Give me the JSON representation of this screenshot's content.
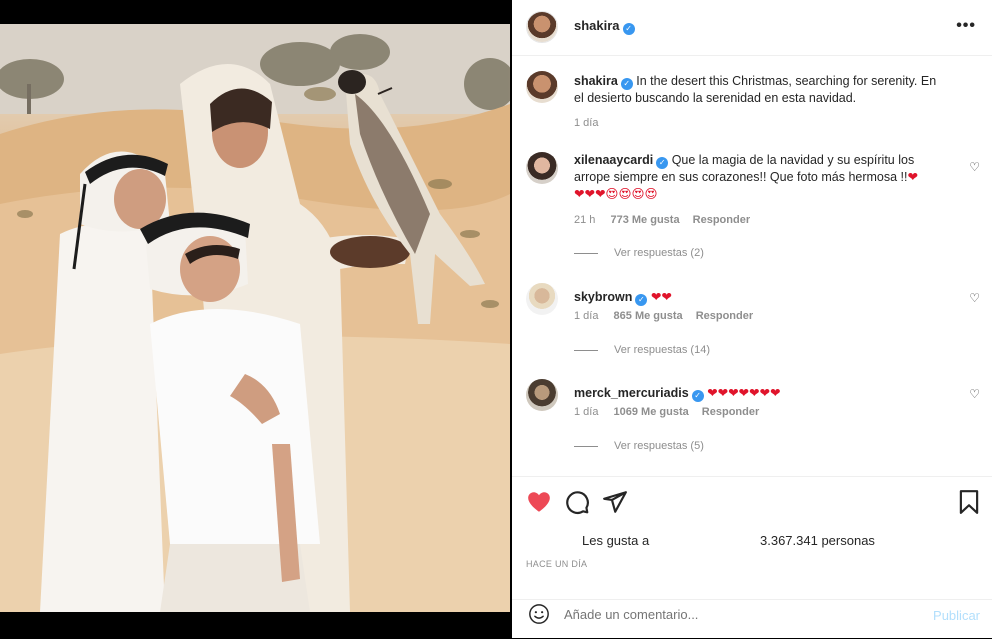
{
  "post": {
    "username": "shakira",
    "more_label": "•••"
  },
  "caption": {
    "username": "shakira",
    "text": "In the desert this Christmas, searching for serenity. En el desierto buscando la serenidad en esta navidad.",
    "time": "1 día"
  },
  "comments": [
    {
      "username": "xilenaaycardi",
      "text": "Que la magia de la navidad y su espíritu los arrope siempre en sus corazones!! Que foto más hermosa !!",
      "emojis_inline": "❤",
      "emojis_line2": "❤❤❤😍😍😍😍",
      "time": "21 h",
      "likes": "773 Me gusta",
      "reply": "Responder",
      "view_replies": "Ver respuestas (2)"
    },
    {
      "username": "skybrown",
      "text": "❤❤",
      "time": "1 día",
      "likes": "865 Me gusta",
      "reply": "Responder",
      "view_replies": "Ver respuestas (14)"
    },
    {
      "username": "merck_mercuriadis",
      "text": "❤❤❤❤❤❤❤",
      "time": "1 día",
      "likes": "1069 Me gusta",
      "reply": "Responder",
      "view_replies": "Ver respuestas (5)"
    }
  ],
  "likes": {
    "label": "Les gusta a",
    "count": "3.367.341 personas"
  },
  "time_ago": "HACE UN DÍA",
  "add_comment": {
    "placeholder": "Añade un comentario...",
    "publish": "Publicar"
  },
  "icons": {
    "like": "heart-filled-icon",
    "comment": "comment-icon",
    "share": "share-icon",
    "save": "bookmark-icon",
    "emoji": "emoji-icon",
    "verified": "verified-badge-icon",
    "like_comment": "heart-outline-icon"
  },
  "colors": {
    "like_red": "#ed4956",
    "verified_blue": "#3897f0",
    "publish_disabled": "#b2dffc",
    "secondary_text": "#8e8e8e"
  }
}
